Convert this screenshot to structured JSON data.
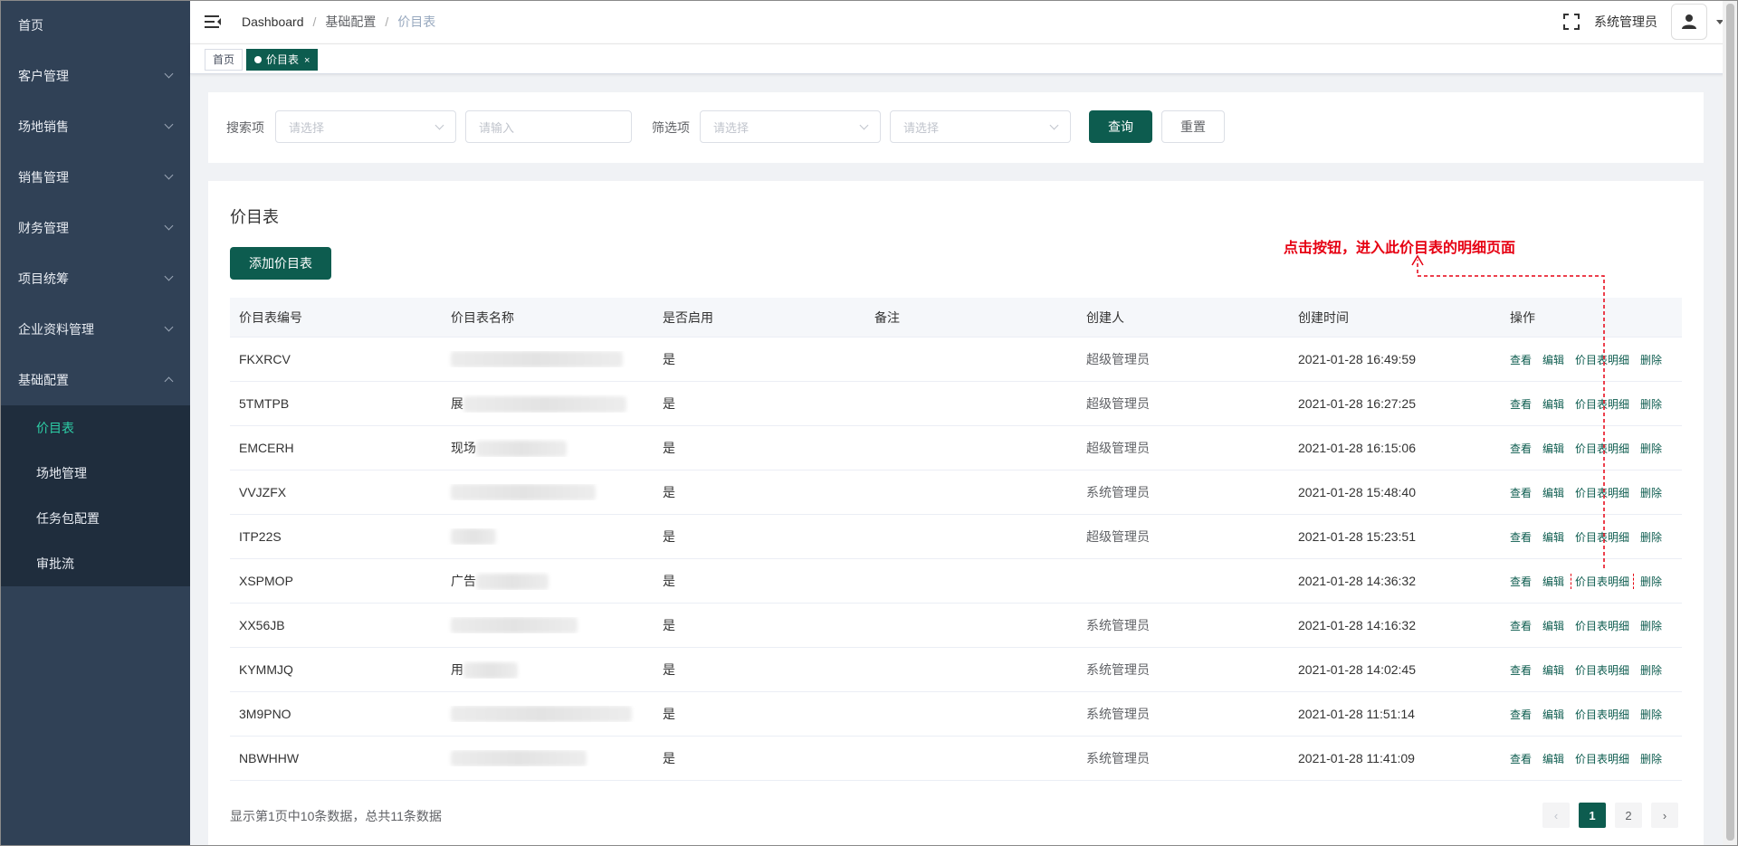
{
  "sidebar": {
    "items": [
      {
        "label": "首页",
        "has_children": false
      },
      {
        "label": "客户管理",
        "has_children": true
      },
      {
        "label": "场地销售",
        "has_children": true
      },
      {
        "label": "销售管理",
        "has_children": true
      },
      {
        "label": "财务管理",
        "has_children": true
      },
      {
        "label": "项目统筹",
        "has_children": true
      },
      {
        "label": "企业资料管理",
        "has_children": true
      },
      {
        "label": "基础配置",
        "has_children": true,
        "expanded": true
      }
    ],
    "submenu": [
      "价目表",
      "场地管理",
      "任务包配置",
      "审批流"
    ],
    "active_sub": "价目表"
  },
  "header": {
    "breadcrumb": [
      "Dashboard",
      "基础配置",
      "价目表"
    ],
    "username": "系统管理员"
  },
  "tags": {
    "home": "首页",
    "active": "价目表",
    "close": "×"
  },
  "search": {
    "label1": "搜索项",
    "select1_placeholder": "请选择",
    "input_placeholder": "请输入",
    "label2": "筛选项",
    "select2_placeholder": "请选择",
    "select3_placeholder": "请选择",
    "query_button": "查询",
    "reset_button": "重置"
  },
  "card": {
    "title": "价目表",
    "add_button": "添加价目表"
  },
  "table": {
    "columns": [
      "价目表编号",
      "价目表名称",
      "是否启用",
      "备注",
      "创建人",
      "创建时间",
      "操作"
    ],
    "rows": [
      {
        "code": "FKXRCV",
        "name_visible": "",
        "enabled": "是",
        "remark": "",
        "creator": "超级管理员",
        "created": "2021-01-28 16:49:59"
      },
      {
        "code": "5TMTPB",
        "name_visible": "展",
        "enabled": "是",
        "remark": "",
        "creator": "超级管理员",
        "created": "2021-01-28 16:27:25"
      },
      {
        "code": "EMCERH",
        "name_visible": "现场",
        "enabled": "是",
        "remark": "",
        "creator": "超级管理员",
        "created": "2021-01-28 16:15:06"
      },
      {
        "code": "VVJZFX",
        "name_visible": "",
        "enabled": "是",
        "remark": "",
        "creator": "系统管理员",
        "created": "2021-01-28 15:48:40"
      },
      {
        "code": "ITP22S",
        "name_visible": "",
        "enabled": "是",
        "remark": "",
        "creator": "超级管理员",
        "created": "2021-01-28 15:23:51"
      },
      {
        "code": "XSPMOP",
        "name_visible": "广告",
        "enabled": "是",
        "remark": "",
        "creator": "",
        "created": "2021-01-28 14:36:32"
      },
      {
        "code": "XX56JB",
        "name_visible": "",
        "enabled": "是",
        "remark": "",
        "creator": "系统管理员",
        "created": "2021-01-28 14:16:32"
      },
      {
        "code": "KYMMJQ",
        "name_visible": "用",
        "enabled": "是",
        "remark": "",
        "creator": "系统管理员",
        "created": "2021-01-28 14:02:45"
      },
      {
        "code": "3M9PNO",
        "name_visible": "",
        "enabled": "是",
        "remark": "",
        "creator": "系统管理员",
        "created": "2021-01-28 11:51:14"
      },
      {
        "code": "NBWHHW",
        "name_visible": "",
        "enabled": "是",
        "remark": "",
        "creator": "系统管理员",
        "created": "2021-01-28 11:41:09"
      }
    ],
    "actions": [
      "查看",
      "编辑",
      "价目表明细",
      "删除"
    ],
    "highlighted_row": 5
  },
  "footer": {
    "summary": "显示第1页中10条数据，总共11条数据",
    "pages": [
      "1",
      "2"
    ],
    "current_page": "1",
    "prev": "‹",
    "next": "›"
  },
  "annotation": {
    "text": "点击按钮，进入此价目表的明细页面",
    "color": "#e60012"
  },
  "colors": {
    "sidebar_bg": "#304156",
    "submenu_bg": "#1f2d3d",
    "primary": "#0d5c4f",
    "active_sub": "#2dcfa7"
  }
}
